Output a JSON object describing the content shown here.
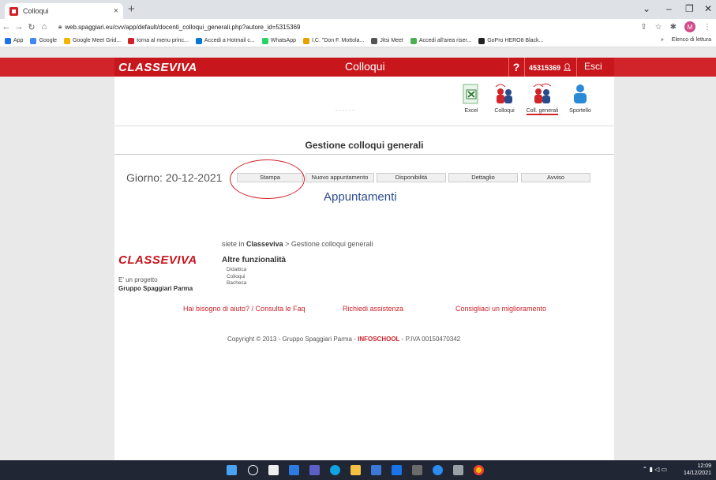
{
  "browser": {
    "tab_title": "Colloqui",
    "tab_close": "×",
    "new_tab": "+",
    "url": "web.spaggiari.eu/cvv/app/default/docenti_colloqui_generali.php?autore_id=5315369",
    "bookmarks": [
      {
        "label": "App",
        "color": "#1a73e8"
      },
      {
        "label": "Google",
        "color": "#4285f4"
      },
      {
        "label": "Google Meet Grid...",
        "color": "#f4b400"
      },
      {
        "label": "torna al menu princ...",
        "color": "#d32027"
      },
      {
        "label": "Accedi a Hotmail c...",
        "color": "#0078d4"
      },
      {
        "label": "WhatsApp",
        "color": "#25d366"
      },
      {
        "label": "I.C. \"Don F. Mottola...",
        "color": "#e8a000"
      },
      {
        "label": "Jitsi Meet",
        "color": "#555555"
      },
      {
        "label": "Accedi all'area riser...",
        "color": "#4caf50"
      },
      {
        "label": "GoPro HERO8 Black...",
        "color": "#222222"
      }
    ],
    "bookmarks_more": "»",
    "reading_list": "Elenco di lettura",
    "profile_initial": "M"
  },
  "header": {
    "logo": "CLASSEVIVA",
    "title": "Colloqui",
    "help": "?",
    "user_id": "45315369",
    "logout": "Esci"
  },
  "toolbar": {
    "faint_text": "- - - - - -",
    "items": [
      {
        "label": "Excel"
      },
      {
        "label": "Colloqui"
      },
      {
        "label": "Coll. generali"
      },
      {
        "label": "Sportello"
      }
    ]
  },
  "main": {
    "section_title": "Gestione colloqui generali",
    "giorno_label": "Giorno:",
    "giorno_value": "20-12-2021",
    "buttons": [
      "Stampa",
      "Nuovo appuntamento",
      "Disponibilità",
      "Dettaglio",
      "Avviso"
    ],
    "appuntamenti": "Appuntamenti"
  },
  "footer": {
    "breadcrumb_prefix": "siete in",
    "breadcrumb_root": "Classeviva",
    "breadcrumb_current": "> Gestione colloqui generali",
    "logo": "CLASSEVIVA",
    "progetto_line": "E' un progetto",
    "progetto_company": "Gruppo Spaggiari Parma",
    "altre_title": "Altre funzionalità",
    "altre_links": [
      "Didattica",
      "Colloqui",
      "Bacheca"
    ],
    "links": [
      "Hai bisogno di aiuto? / Consulta le Faq",
      "Richiedi assistenza",
      "Consigliaci un miglioramento"
    ],
    "copyright_prefix": "Copyright © 2013 - Gruppo Spaggiari Parma -",
    "copyright_brand": "INFOSCHOOL",
    "copyright_suffix": "- P.IVA 00150470342"
  },
  "taskbar": {
    "time": "12:09",
    "date": "14/12/2021"
  },
  "colors": {
    "brand_red": "#d0232a",
    "link_blue": "#2b4b8c"
  }
}
